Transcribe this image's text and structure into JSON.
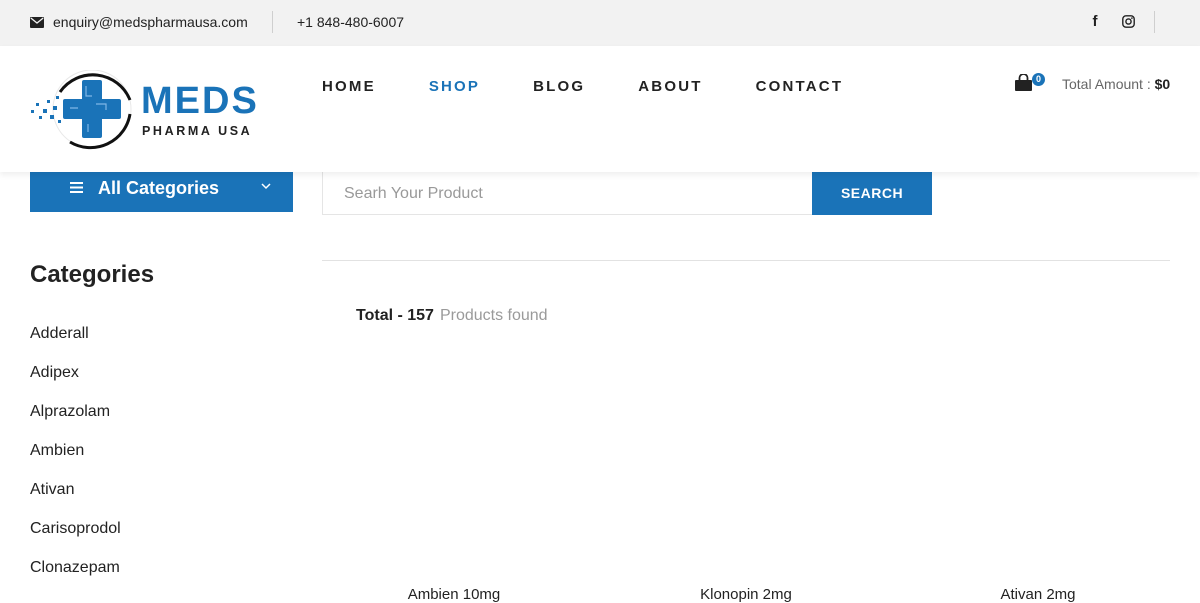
{
  "topbar": {
    "email": "enquiry@medspharmausa.com",
    "phone": "+1 848-480-6007",
    "facebook_icon": "f"
  },
  "logo": {
    "brand": "MEDS",
    "subtitle": "PHARMA USA"
  },
  "nav": {
    "items": [
      "HOME",
      "SHOP",
      "BLOG",
      "ABOUT",
      "CONTACT"
    ],
    "active": "SHOP"
  },
  "cart": {
    "count": "0",
    "total_label": "Total Amount : ",
    "total_value": "$0"
  },
  "categories_button": {
    "label": "All Categories"
  },
  "search": {
    "placeholder": "Searh Your Product",
    "button_label": "SEARCH"
  },
  "results": {
    "total_label": "Total - 157",
    "found_label": "Products found"
  },
  "sidebar": {
    "title": "Categories",
    "items": [
      "Adderall",
      "Adipex",
      "Alprazolam",
      "Ambien",
      "Ativan",
      "Carisoprodol",
      "Clonazepam"
    ]
  },
  "products": [
    {
      "title": "Ambien 10mg"
    },
    {
      "title": "Klonopin 2mg"
    },
    {
      "title": "Ativan 2mg"
    }
  ],
  "colors": {
    "accent": "#1a73b8",
    "topbar_bg": "#f2f2f2",
    "text": "#222222",
    "muted": "#9a9a9a"
  }
}
